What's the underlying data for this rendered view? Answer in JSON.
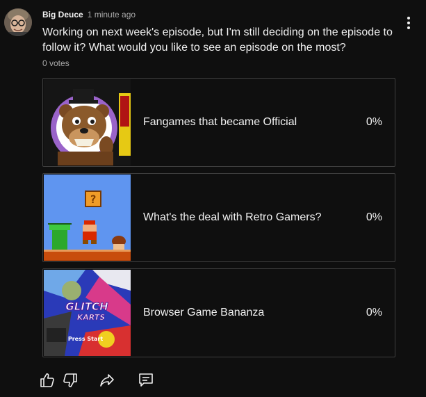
{
  "post": {
    "author": "Big Deuce",
    "timestamp": "1 minute ago",
    "question": "Working on next week's episode, but I'm still deciding on the episode to follow it? What would you like to see an episode on the most?",
    "votes": "0 votes"
  },
  "poll": {
    "options": [
      {
        "label": "Fangames that became Official",
        "percent": "0%",
        "thumbnail": "animatronic-bear-thumbnail"
      },
      {
        "label": "What's the deal with Retro Gamers?",
        "percent": "0%",
        "thumbnail": "retro-platformer-thumbnail"
      },
      {
        "label": "Browser Game Bananza",
        "percent": "0%",
        "thumbnail": "glitch-karts-thumbnail"
      }
    ],
    "thumbnail_text": {
      "game_logo_line1": "GLITCH",
      "game_logo_line2": "KARTS",
      "press_start": "Press Start"
    }
  },
  "actions": [
    {
      "name": "like",
      "icon": "thumbs-up-icon"
    },
    {
      "name": "dislike",
      "icon": "thumbs-down-icon"
    },
    {
      "name": "share",
      "icon": "share-icon"
    },
    {
      "name": "comment",
      "icon": "comment-icon"
    }
  ],
  "colors": {
    "background": "#0f0f0f",
    "text_primary": "#f1f1f1",
    "text_secondary": "#aaaaaa",
    "option_border": "#3f3f3f"
  }
}
